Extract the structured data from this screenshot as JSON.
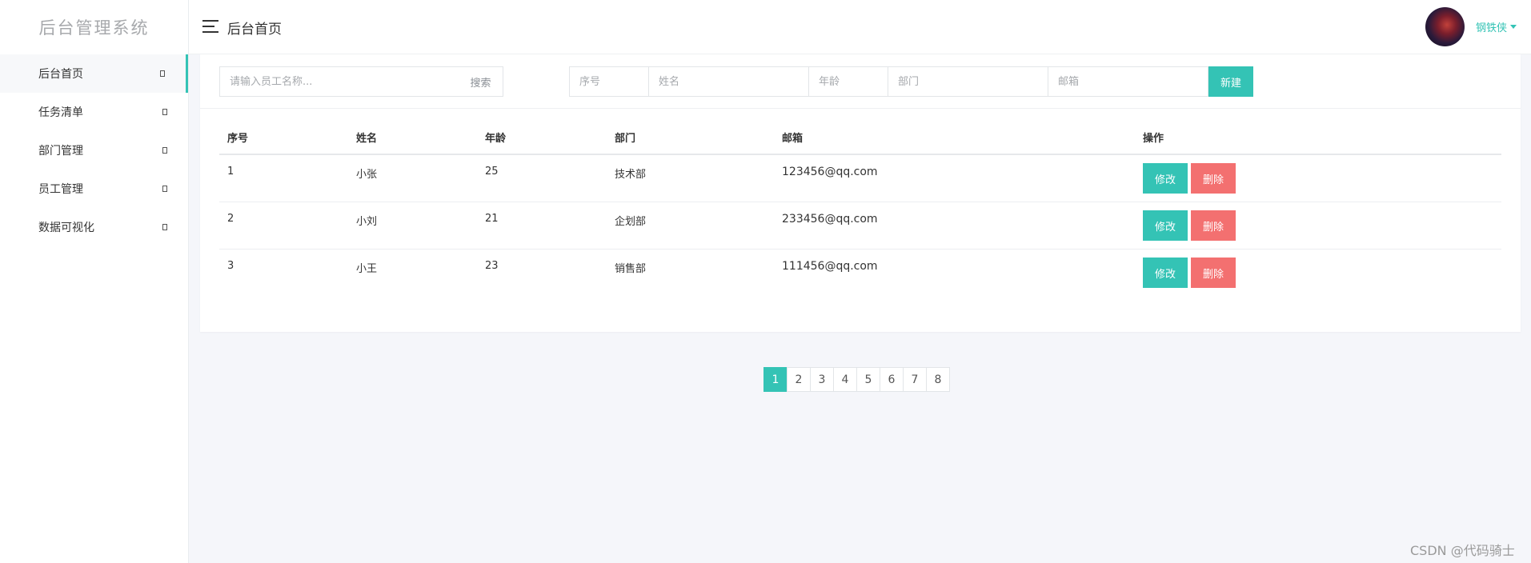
{
  "sidebar": {
    "brand": "后台管理系统",
    "items": [
      {
        "label": "后台首页"
      },
      {
        "label": "任务清单"
      },
      {
        "label": "部门管理"
      },
      {
        "label": "员工管理"
      },
      {
        "label": "数据可视化"
      }
    ]
  },
  "header": {
    "title": "后台首页",
    "user_name": "钢铁侠"
  },
  "toolbar": {
    "search_placeholder": "请输入员工名称...",
    "search_label": "搜索",
    "id_placeholder": "序号",
    "name_placeholder": "姓名",
    "age_placeholder": "年龄",
    "dept_placeholder": "部门",
    "email_placeholder": "邮箱",
    "new_label": "新建"
  },
  "table": {
    "columns": [
      "序号",
      "姓名",
      "年龄",
      "部门",
      "邮箱",
      "操作"
    ],
    "rows": [
      {
        "id": "1",
        "name": "小张",
        "age": "25",
        "dept": "技术部",
        "email": "123456@qq.com"
      },
      {
        "id": "2",
        "name": "小刘",
        "age": "21",
        "dept": "企划部",
        "email": "233456@qq.com"
      },
      {
        "id": "3",
        "name": "小王",
        "age": "23",
        "dept": "销售部",
        "email": "111456@qq.com"
      }
    ],
    "edit_label": "修改",
    "delete_label": "删除"
  },
  "pagination": {
    "pages": [
      "1",
      "2",
      "3",
      "4",
      "5",
      "6",
      "7",
      "8"
    ],
    "current": "1"
  },
  "watermark": "CSDN @代码骑士",
  "colors": {
    "accent": "#34c3b5",
    "danger": "#f37070"
  },
  "icons": {
    "menu": "hamburger-menu-icon",
    "caret": "caret-down-icon",
    "nav_arrow": "chevron-right-icon"
  }
}
